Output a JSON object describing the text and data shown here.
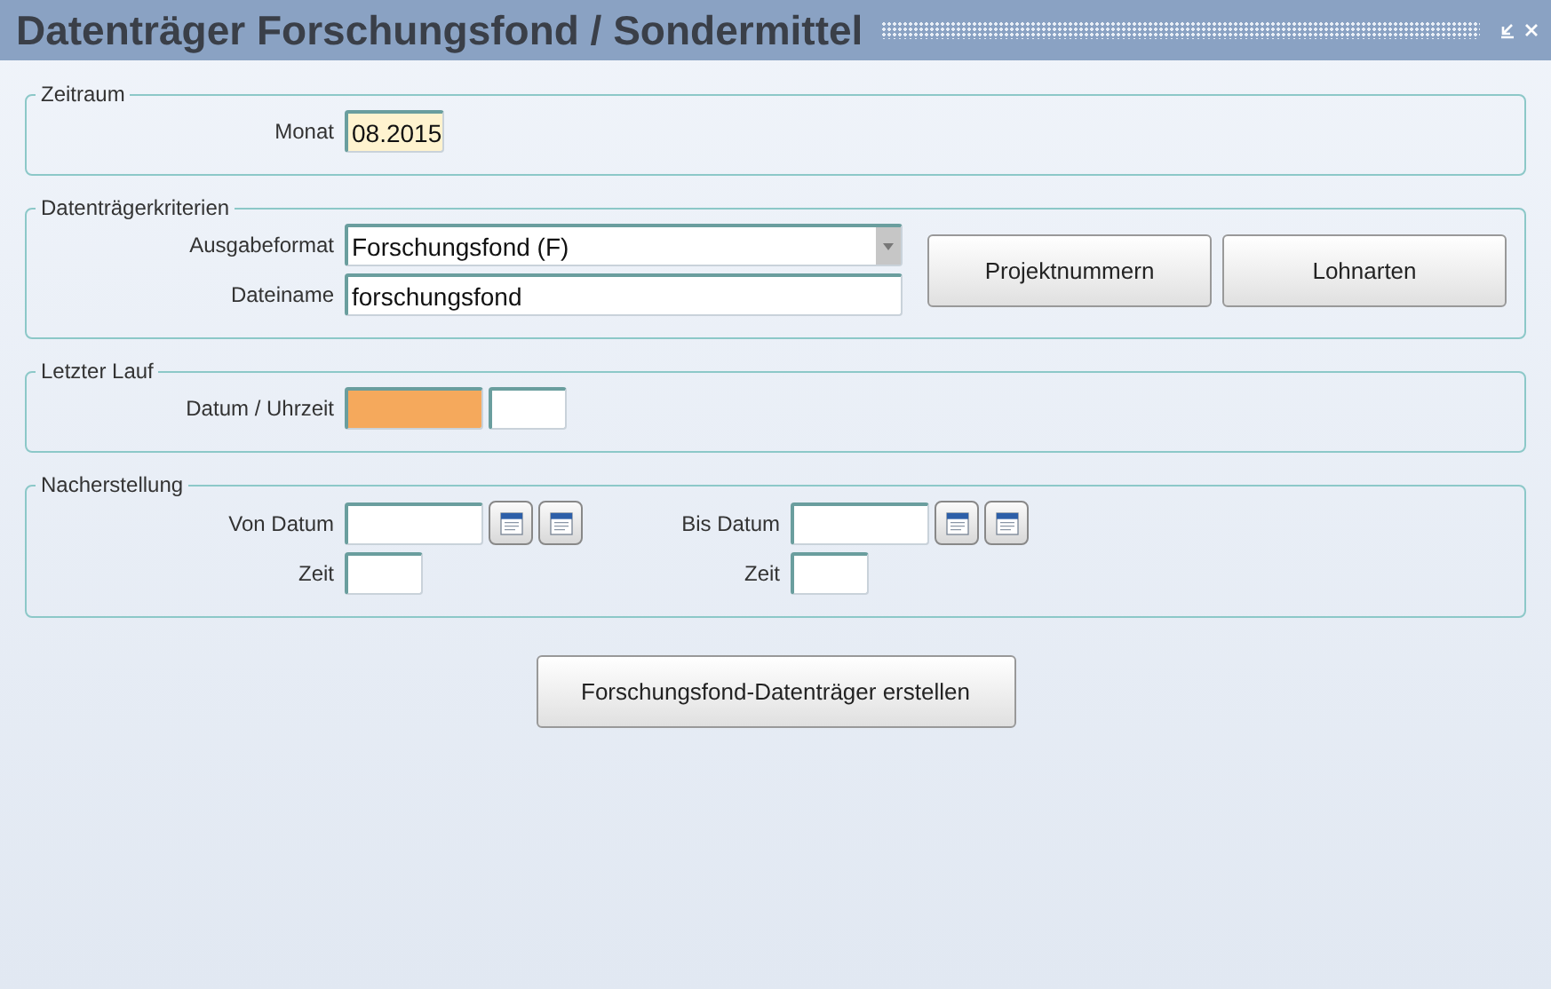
{
  "window": {
    "title": "Datenträger Forschungsfond / Sondermittel"
  },
  "sections": [
    {
      "title": "Zeitraum",
      "rows": [
        {
          "label": "Monat",
          "fields": [
            {
              "kind": "month",
              "value": "08.2015",
              "focused": true
            }
          ]
        }
      ]
    },
    {
      "title": "Datenträgerkriterien",
      "rows": [
        {
          "label": "Ausgabeformat",
          "fields": [
            {
              "kind": "select",
              "value": "Forschungsfond (F)"
            }
          ]
        },
        {
          "label": "Dateiname",
          "fields": [
            {
              "kind": "text",
              "value": "forschungsfond"
            }
          ]
        }
      ],
      "buttons": [
        "Projektnummern",
        "Lohnarten"
      ]
    },
    {
      "title": "Letzter Lauf",
      "rows": [
        {
          "label": "Datum / Uhrzeit",
          "fields": [
            {
              "kind": "date",
              "required": true
            },
            {
              "kind": "time"
            }
          ]
        }
      ]
    },
    {
      "title": "Nacherstellung",
      "columns": [
        [
          {
            "label": "Von Datum",
            "fields": [
              {
                "kind": "date"
              },
              {
                "kind": "calendar"
              },
              {
                "kind": "calendar"
              }
            ]
          },
          {
            "label": "Zeit",
            "fields": [
              {
                "kind": "time"
              }
            ]
          }
        ],
        [
          {
            "label": "Bis Datum",
            "fields": [
              {
                "kind": "date"
              },
              {
                "kind": "calendar"
              },
              {
                "kind": "calendar"
              }
            ]
          },
          {
            "label": "Zeit",
            "fields": [
              {
                "kind": "time"
              }
            ]
          }
        ]
      ]
    }
  ],
  "action_button": "Forschungsfond-Datenträger erstellen"
}
